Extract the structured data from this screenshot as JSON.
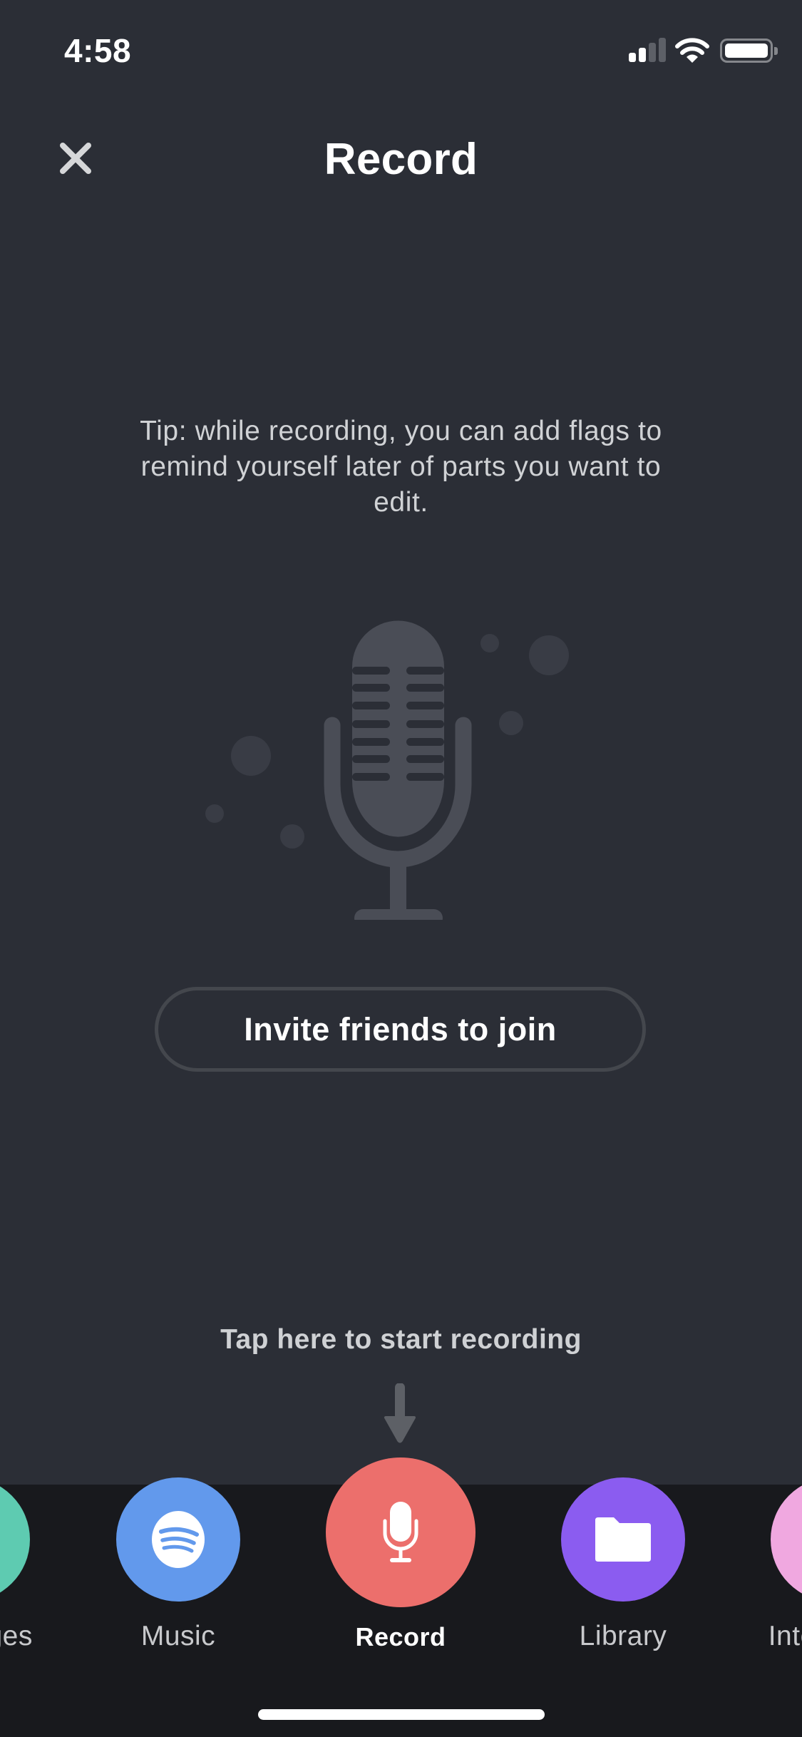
{
  "status_bar": {
    "time": "4:58",
    "signal_bars_total": 4,
    "signal_bars_active": 2,
    "wifi_icon": "wifi-icon",
    "battery_icon": "battery-icon"
  },
  "header": {
    "title": "Record",
    "close_icon": "close-icon"
  },
  "tip": {
    "text": "Tip: while recording, you can add flags to remind yourself later of parts you want to edit."
  },
  "illustration": {
    "icon": "microphone-icon"
  },
  "invite_button": {
    "label": "Invite friends to join"
  },
  "hint": {
    "text": "Tap here to start recording",
    "icon": "arrow-down-icon"
  },
  "tabbar": {
    "items": [
      {
        "id": "messages",
        "label": "Messages",
        "icon": "message-icon",
        "color": "#5ecbb1",
        "active": false
      },
      {
        "id": "music",
        "label": "Music",
        "icon": "spotify-icon",
        "color": "#6299ec",
        "active": false
      },
      {
        "id": "record",
        "label": "Record",
        "icon": "microphone-icon",
        "color": "#ec6f6c",
        "active": true
      },
      {
        "id": "library",
        "label": "Library",
        "icon": "folder-icon",
        "color": "#8b5cf0",
        "active": false
      },
      {
        "id": "interviews",
        "label": "Interviews",
        "icon": "interview-icon",
        "color": "#f0a8e0",
        "active": false
      }
    ]
  },
  "colors": {
    "background": "#2b2e36",
    "tabbar_background": "#18191d",
    "illustration": "#4a4d56",
    "accent_record": "#ec6f6c"
  }
}
